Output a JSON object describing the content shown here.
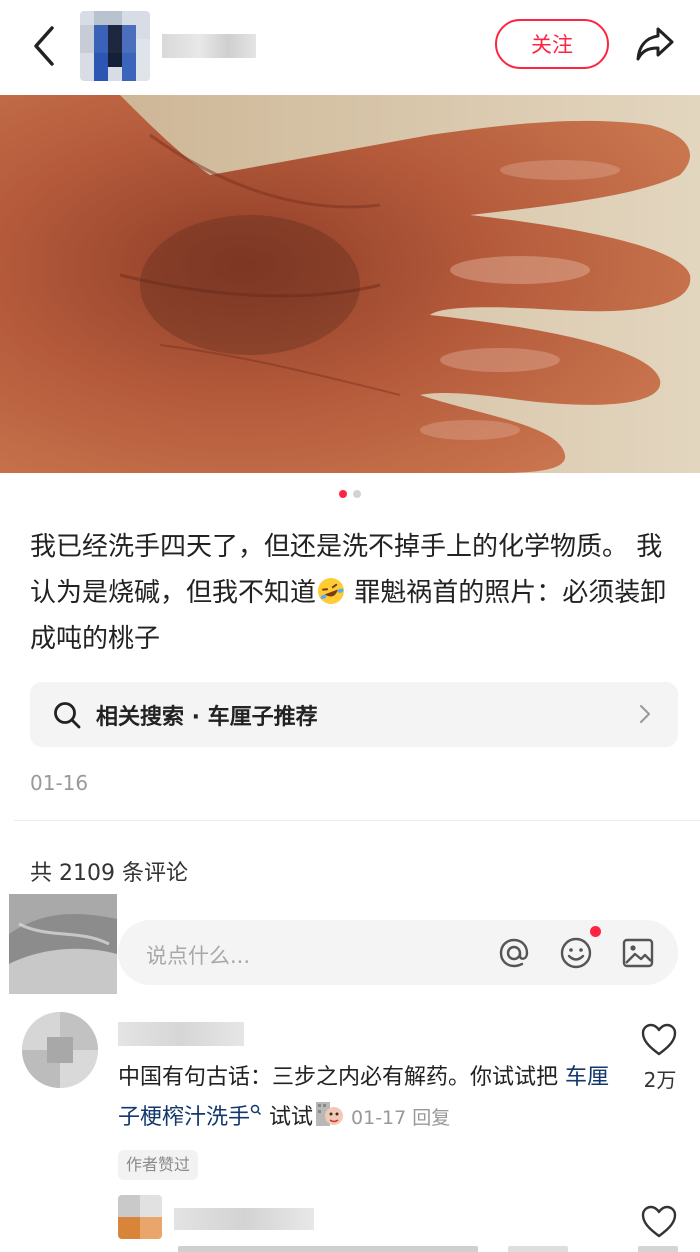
{
  "header": {
    "back_icon": "chevron-left-icon",
    "follow_label": "关注",
    "share_icon": "share-icon",
    "accent_color": "#ff2442"
  },
  "carousel": {
    "total": 2,
    "current": 1
  },
  "post": {
    "text_before_emoji": "我已经洗手四天了，但还是洗不掉手上的化学物质。 我认为是烧碱，但我不知道",
    "emoji": "rofl-emoji",
    "text_after_emoji": " 罪魁祸首的照片：必须装卸成吨的桃子",
    "date": "01-16"
  },
  "related_search": {
    "label": "相关搜索 · 车厘子推荐"
  },
  "comments": {
    "count_label": "共 2109 条评论",
    "input_placeholder": "说点什么...",
    "items": [
      {
        "text": "中国有句古话：三步之内必有解药。你试试把 ",
        "link": "车厘子梗榨汁洗手",
        "after_link": " 试试",
        "sticker": "sticker-icon",
        "date": "01-17",
        "reply_label": "回复",
        "badge": "作者赞过",
        "likes": "2万"
      }
    ]
  }
}
